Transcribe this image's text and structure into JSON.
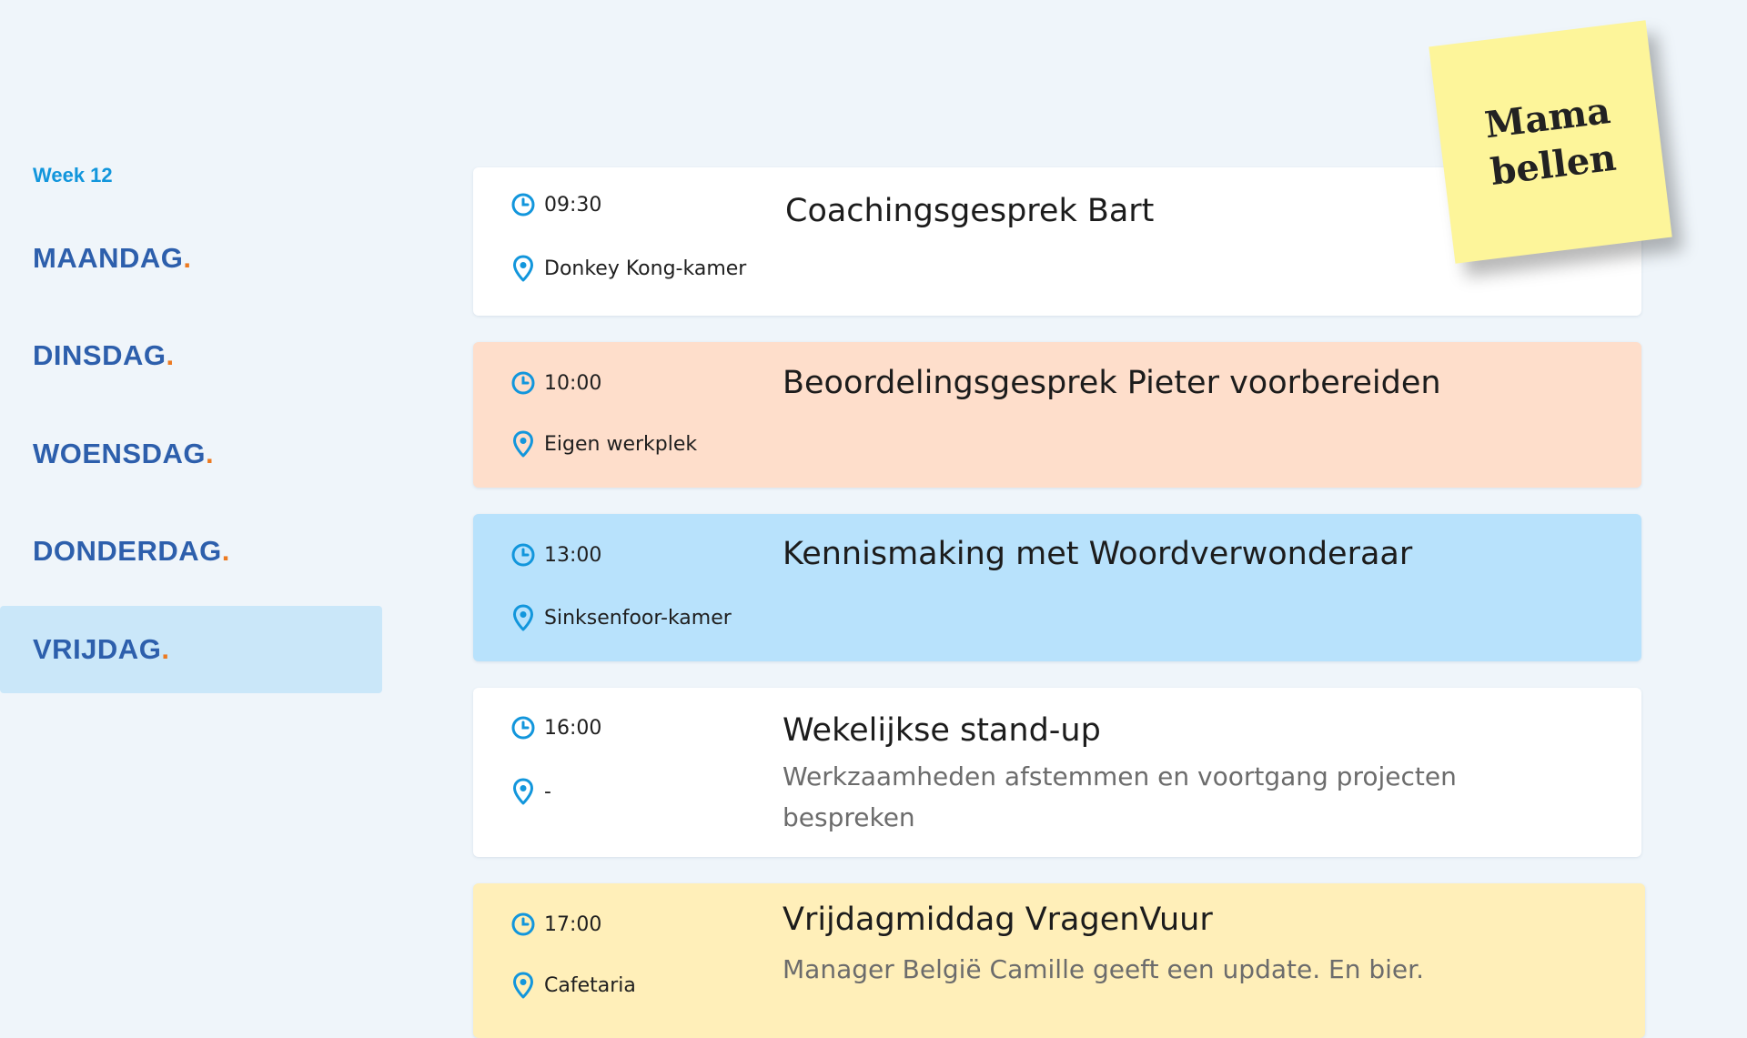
{
  "sidebar": {
    "week": "Week 12",
    "days": [
      {
        "label": "MAANDAG",
        "dot": "."
      },
      {
        "label": "DINSDAG",
        "dot": "."
      },
      {
        "label": "WOENSDAG",
        "dot": "."
      },
      {
        "label": "DONDERDAG",
        "dot": "."
      },
      {
        "label": "VRIJDAG",
        "dot": "."
      }
    ],
    "active_day": "VRIJDAG"
  },
  "events": [
    {
      "time": "09:30",
      "location": "Donkey Kong-kamer",
      "title": "Coachingsgesprek Bart",
      "color": "#ffffff"
    },
    {
      "time": "10:00",
      "location": "Eigen werkplek",
      "title": "Beoordelingsgesprek Pieter voorbereiden",
      "color": "#fedecb"
    },
    {
      "time": "13:00",
      "location": "Sinksenfoor-kamer",
      "title": "Kennismaking met Woordverwonderaar",
      "color": "#b8e2fc"
    },
    {
      "time": "16:00",
      "location": "-",
      "title": "Wekelijkse stand-up",
      "description": "Werkzaamheden afstemmen en voortgang projecten bespreken",
      "color": "#ffffff"
    },
    {
      "time": "17:00",
      "location": "Cafetaria",
      "title": "Vrijdagmiddag VragenVuur",
      "description": "Manager België Camille geeft een update. En bier.",
      "color": "#ffefb9"
    }
  ],
  "sticky_note": {
    "line1": "Mama",
    "line2": "bellen",
    "color": "#fdf59a"
  },
  "colors": {
    "accent": "#1296dc",
    "day_text": "#2d5fac",
    "dot": "#ec7a21",
    "active_day_bg": "#cae7f9"
  },
  "icons": {
    "time": "clock-icon",
    "location": "map-pin-icon"
  }
}
